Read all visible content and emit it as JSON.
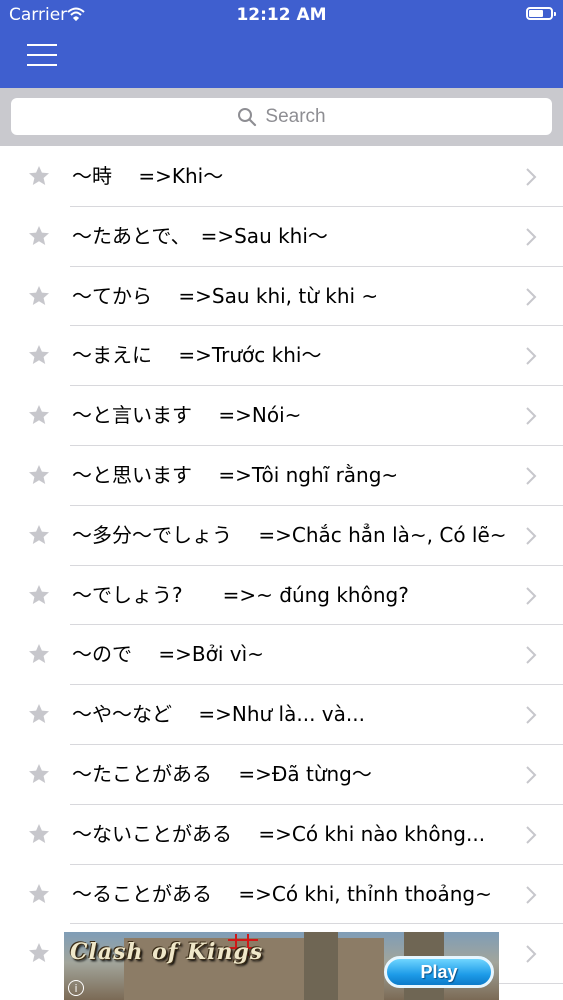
{
  "status_bar": {
    "carrier": "Carrier",
    "time": "12:12 AM"
  },
  "search": {
    "placeholder": "Search"
  },
  "grammar_list": [
    {
      "label": "～時　 =>Khi～"
    },
    {
      "label": "～たあとで、　=>Sau khi～"
    },
    {
      "label": "～てから　 =>Sau khi, từ khi ~"
    },
    {
      "label": "～まえに　 =>Trước khi～"
    },
    {
      "label": "～と言います　 =>Nói~"
    },
    {
      "label": "～と思います　 =>Tôi nghĩ rằng~"
    },
    {
      "label": "～多分～でしょう　 =>Chắc hẳn là~, Có lẽ~"
    },
    {
      "label": "～でしょう?　　=>~ đúng không?"
    },
    {
      "label": "～ので　 =>Bởi vì~"
    },
    {
      "label": "～や～など　 =>Như là... và..."
    },
    {
      "label": "～たことがある　 =>Đã từng～"
    },
    {
      "label": "～ないことがある　 =>Có khi nào không..."
    },
    {
      "label": "～ることがある　 =>Có khi, thỉnh thoảng~"
    },
    {
      "label": ""
    }
  ],
  "ad": {
    "title": "Clash of Kings",
    "button_label": "Play",
    "info_label": "i"
  },
  "colors": {
    "header": "#3f5fcf",
    "search_background": "#c9c9ce",
    "star": "#c7c7cc",
    "chevron": "#c7c7cc"
  }
}
